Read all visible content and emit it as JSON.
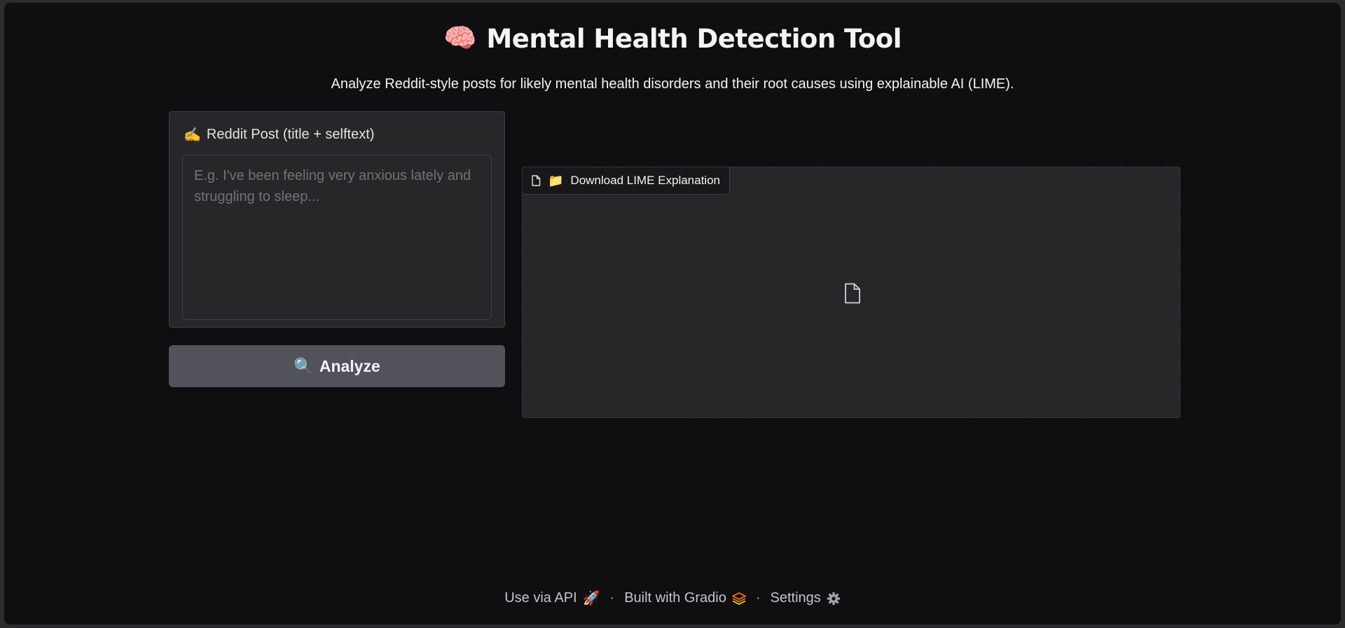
{
  "header": {
    "title_emoji": "🧠",
    "title": "Mental Health Detection Tool",
    "subtitle": "Analyze Reddit-style posts for likely mental health disorders and their root causes using explainable AI (LIME)."
  },
  "input": {
    "label_emoji": "✍️",
    "label": "Reddit Post (title + selftext)",
    "value": "",
    "placeholder": "E.g. I've been feeling very anxious lately and struggling to sleep..."
  },
  "analyze_button": {
    "emoji": "🔍",
    "label": "Analyze"
  },
  "file_output": {
    "label_emoji": "📁",
    "label": "Download LIME Explanation"
  },
  "footer": {
    "api": "Use via API",
    "api_emoji": "🚀",
    "separator": "·",
    "built": "Built with Gradio",
    "settings": "Settings"
  },
  "colors": {
    "background": "#0f0f11",
    "panel": "#27272a",
    "button": "#52525b",
    "gradio_orange": "#f97316"
  }
}
